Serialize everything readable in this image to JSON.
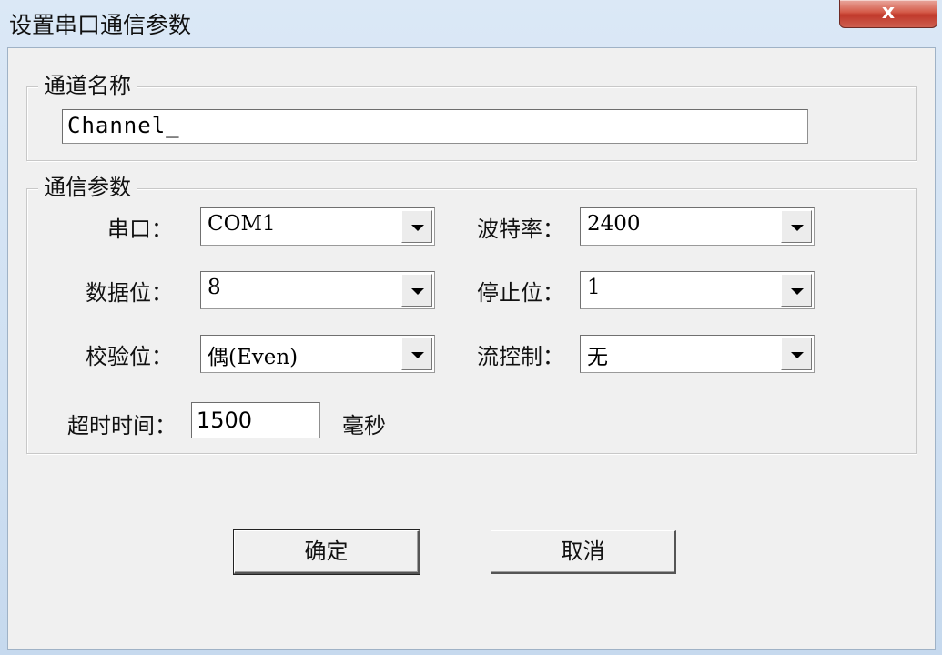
{
  "window": {
    "title": "设置串口通信参数",
    "close_label": "x"
  },
  "channel_group": {
    "title": "通道名称",
    "name_value": "Channel_"
  },
  "comm_group": {
    "title": "通信参数",
    "port": {
      "label": "串口：",
      "value": "COM1"
    },
    "baud": {
      "label": "波特率：",
      "value": "2400"
    },
    "databits": {
      "label": "数据位：",
      "value": "8"
    },
    "stopbits": {
      "label": "停止位：",
      "value": "1"
    },
    "parity": {
      "label": "校验位：",
      "value": "偶(Even)"
    },
    "flow": {
      "label": "流控制：",
      "value": "无"
    },
    "timeout": {
      "label": "超时时间：",
      "value": "1500",
      "unit": "毫秒"
    }
  },
  "buttons": {
    "ok": "确定",
    "cancel": "取消"
  }
}
